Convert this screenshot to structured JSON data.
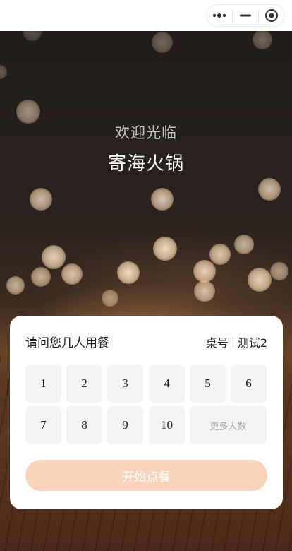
{
  "nav": {
    "capsule": {
      "more_icon": "more-dots-icon",
      "minimize_icon": "minimize-icon",
      "close_icon": "target-close-icon"
    }
  },
  "hero": {
    "welcome": "欢迎光临",
    "store_name": "寄海火锅"
  },
  "card": {
    "question": "请问您几人用餐",
    "table_label": "桌号",
    "table_value": "测试2",
    "party_sizes": [
      "1",
      "2",
      "3",
      "4",
      "5",
      "6",
      "7",
      "8",
      "9",
      "10"
    ],
    "more_label": "更多人数",
    "start_label": "开始点餐"
  },
  "colors": {
    "start_button": "#f9d4bb",
    "number_button_bg": "#f4f4f4"
  }
}
